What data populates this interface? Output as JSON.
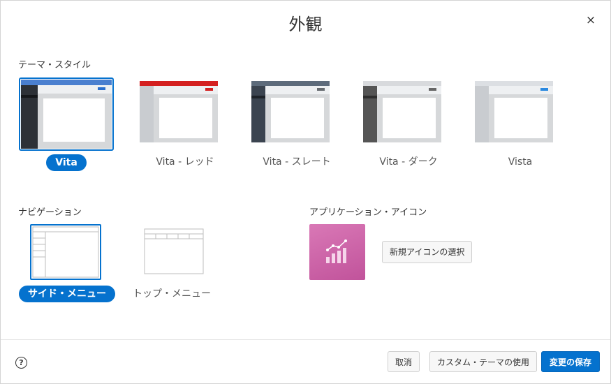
{
  "dialog": {
    "title": "外観",
    "close_label": "×"
  },
  "theme_style": {
    "label": "テーマ・スタイル",
    "items": [
      {
        "label": "Vita",
        "selected": true,
        "header_color": "#4a7fcf",
        "sidebar_color": "#2d3137",
        "accent": "#2b6fcd"
      },
      {
        "label": "Vita - レッド",
        "selected": false,
        "header_color": "#d42020",
        "sidebar_color": "#c9ccd0",
        "accent": "#d42020"
      },
      {
        "label": "Vita - スレート",
        "selected": false,
        "header_color": "#5d6b7b",
        "sidebar_color": "#3b4450",
        "accent": "#666b70"
      },
      {
        "label": "Vita - ダーク",
        "selected": false,
        "header_color": "#d8dadd",
        "sidebar_color": "#555555",
        "accent": "#666666"
      },
      {
        "label": "Vista",
        "selected": false,
        "header_color": "#dcdfe3",
        "sidebar_color": "#c9ccd0",
        "accent": "#2b89e0"
      }
    ]
  },
  "navigation": {
    "label": "ナビゲーション",
    "items": [
      {
        "label": "サイド・メニュー",
        "selected": true
      },
      {
        "label": "トップ・メニュー",
        "selected": false
      }
    ]
  },
  "app_icon": {
    "label": "アプリケーション・アイコン",
    "select_button": "新規アイコンの選択",
    "icon": "bar-chart-trend-icon",
    "color": "#c75aa4"
  },
  "footer": {
    "help_label": "?",
    "cancel": "取消",
    "custom_theme": "カスタム・テーマの使用",
    "save": "変更の保存"
  }
}
